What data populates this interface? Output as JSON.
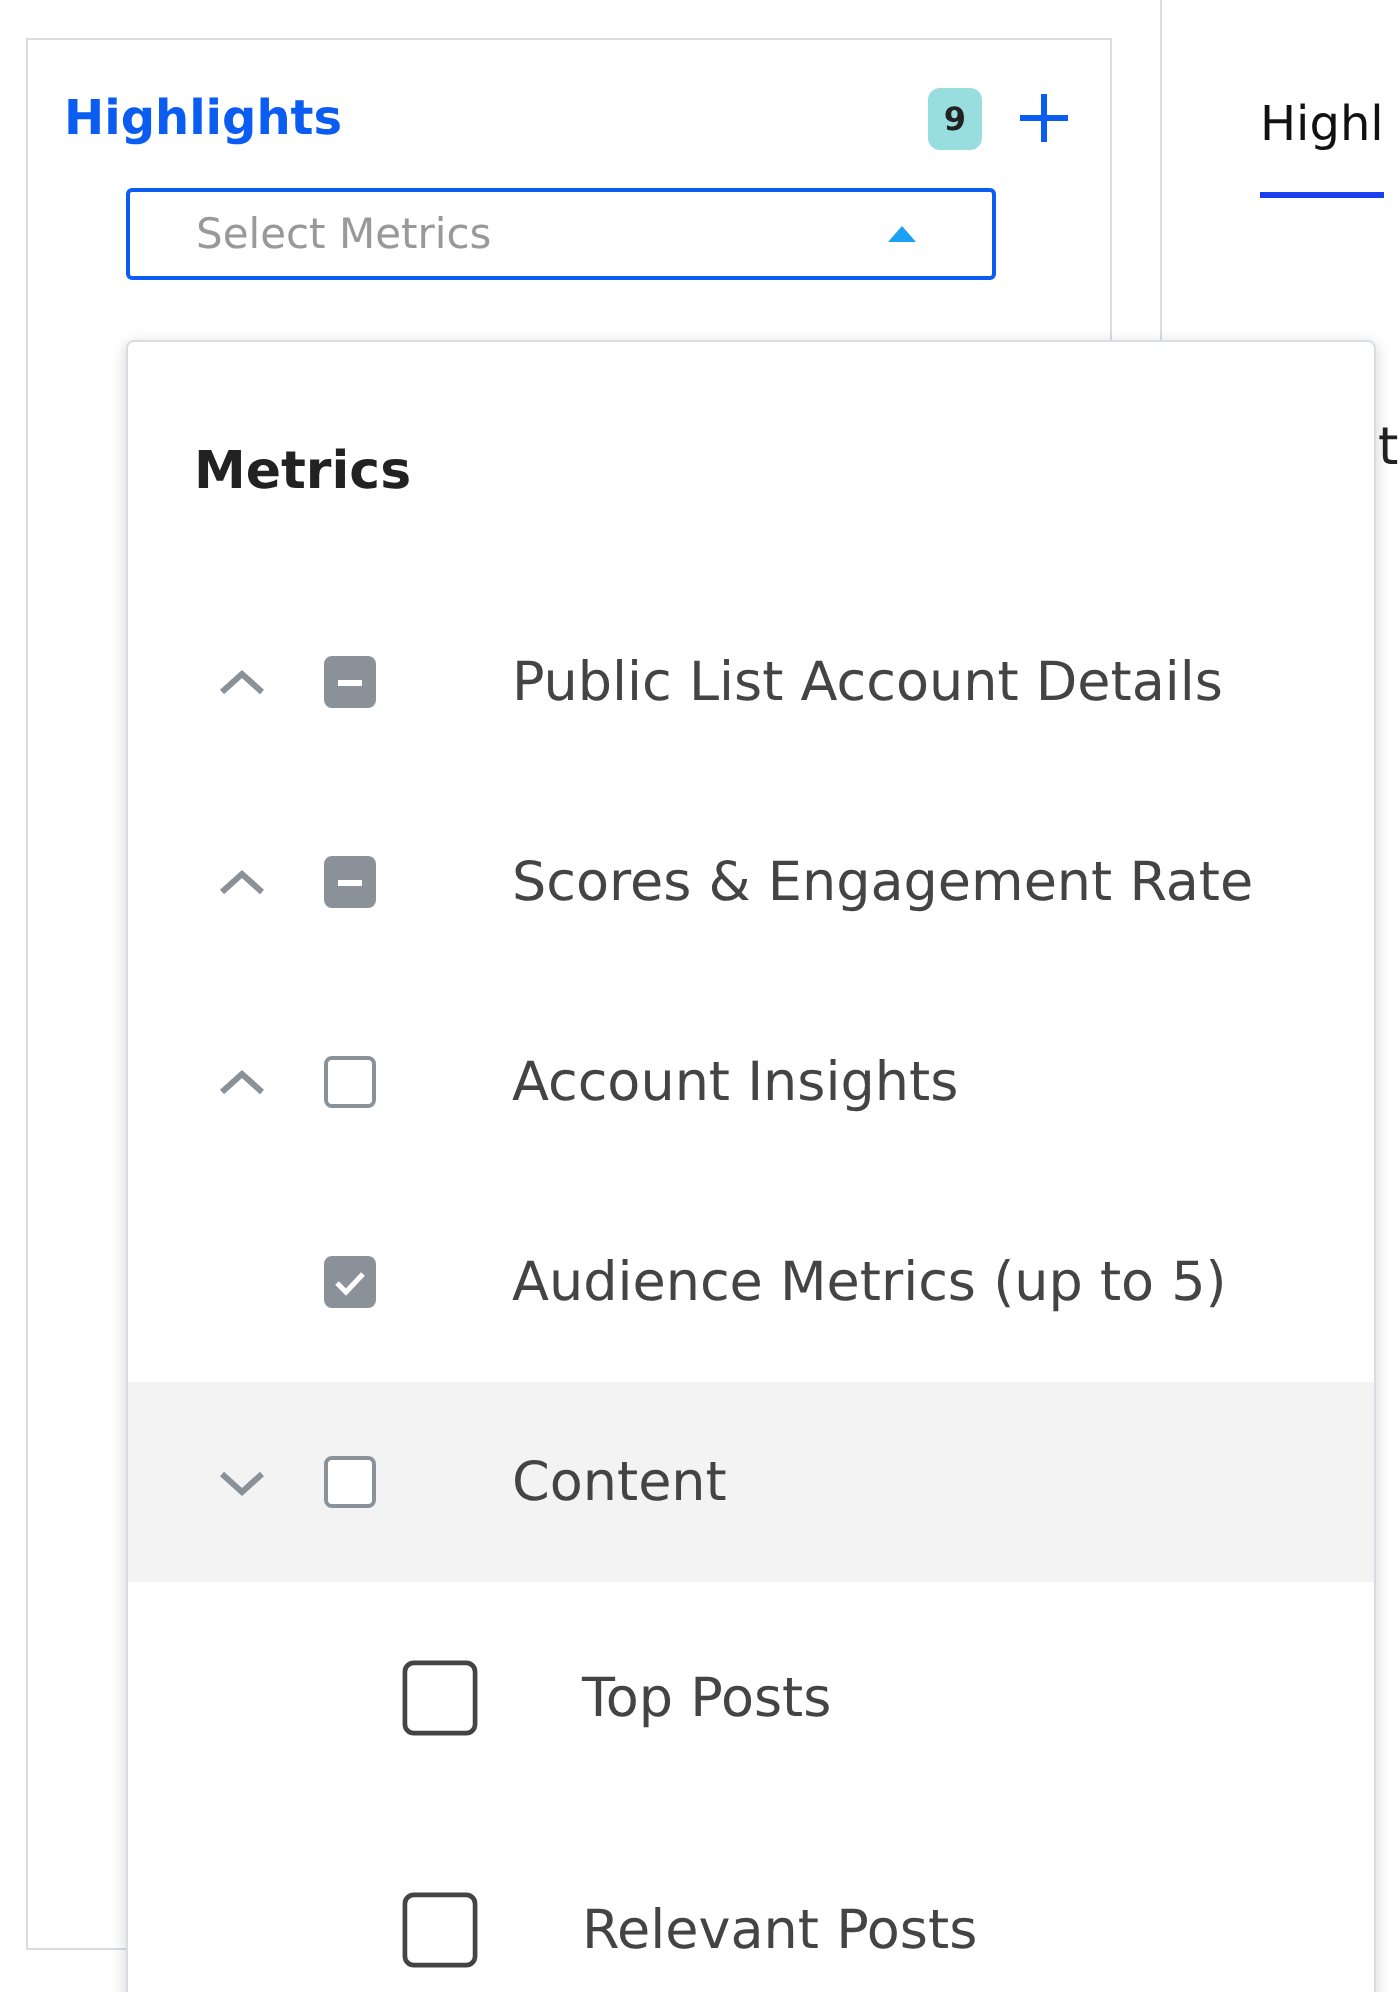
{
  "panel": {
    "title": "Highlights",
    "count": "9"
  },
  "select": {
    "placeholder": "Select Metrics",
    "open": true
  },
  "dropdown": {
    "heading": "Metrics",
    "items": [
      {
        "label": "Public List Account Details",
        "expanded": false,
        "checked": false,
        "partial": true,
        "highlighted": false
      },
      {
        "label": "Scores & Engagement Rate",
        "expanded": false,
        "checked": false,
        "partial": true,
        "highlighted": false
      },
      {
        "label": "Account Insights",
        "expanded": false,
        "checked": false,
        "partial": false,
        "highlighted": false
      },
      {
        "label": "Audience Metrics (up to 5)",
        "checked": true,
        "partial": false,
        "highlighted": false
      },
      {
        "label": "Content",
        "expanded": true,
        "checked": false,
        "partial": false,
        "highlighted": true,
        "children": [
          {
            "label": "Top Posts",
            "checked": false
          },
          {
            "label": "Relevant Posts",
            "checked": false
          }
        ]
      }
    ]
  },
  "background": {
    "tabs": [
      {
        "label": "Highl",
        "selected": true
      }
    ],
    "fragments": [
      "t"
    ]
  }
}
